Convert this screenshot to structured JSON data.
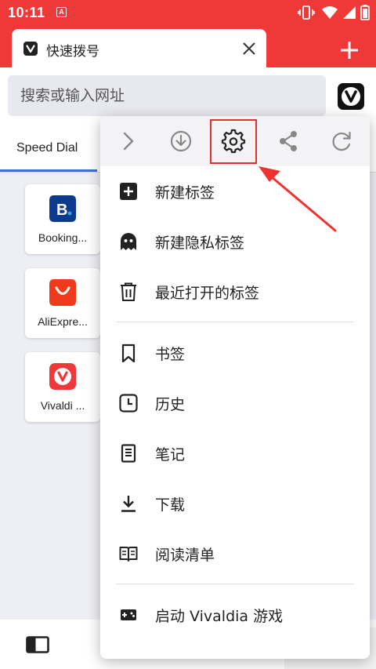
{
  "status_bar": {
    "time": "10:11",
    "app_icon_letter": "A"
  },
  "tab": {
    "title": "快速拨号"
  },
  "address_bar": {
    "placeholder": "搜索或输入网址"
  },
  "speed_dial": {
    "tab_label": "Speed Dial",
    "tiles": [
      {
        "label": "Booking...",
        "icon": "booking-icon",
        "color": "#0c3b8e"
      },
      {
        "label": "AliExpre...",
        "icon": "aliexpress-icon",
        "color": "#ef3a1c"
      },
      {
        "label": "Vivaldi ...",
        "icon": "vivaldi-icon",
        "color": "#ef3939"
      }
    ]
  },
  "menu": {
    "toolbar": [
      "forward-icon",
      "download-icon",
      "settings-icon",
      "share-icon",
      "reload-icon"
    ],
    "items": [
      {
        "label": "新建标签",
        "icon": "new-tab-icon"
      },
      {
        "label": "新建隐私标签",
        "icon": "ghost-icon"
      },
      {
        "label": "最近打开的标签",
        "icon": "trash-icon"
      },
      {
        "label": "书签",
        "icon": "bookmark-icon"
      },
      {
        "label": "历史",
        "icon": "history-icon"
      },
      {
        "label": "笔记",
        "icon": "notes-icon"
      },
      {
        "label": "下载",
        "icon": "download-icon"
      },
      {
        "label": "阅读清单",
        "icon": "reading-list-icon"
      },
      {
        "label": "启动 Vivaldia 游戏",
        "icon": "gamepad-icon"
      }
    ]
  },
  "colors": {
    "brand": "#ef3939",
    "highlight": "#e53030",
    "accent": "#3d6fd6"
  }
}
